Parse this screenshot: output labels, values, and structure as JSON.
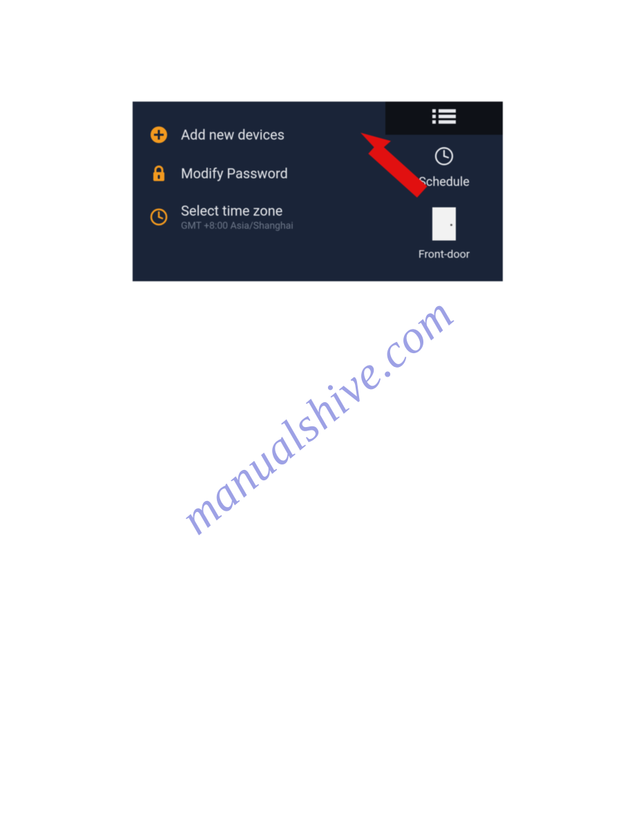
{
  "colors": {
    "panel_bg": "#1a2438",
    "topbar_bg": "#0e1117",
    "accent_orange": "#f39a1f",
    "text_primary": "#e6e8ec",
    "text_muted": "#6d7789",
    "arrow_red": "#e11010",
    "watermark": "#6a6fd8"
  },
  "menu": {
    "items": [
      {
        "label": "Add new devices",
        "icon": "plus-icon"
      },
      {
        "label": "Modify Password",
        "icon": "lock-icon"
      },
      {
        "label": "Select time zone",
        "sub": "GMT +8:00  Asia/Shanghai",
        "icon": "clock-icon"
      }
    ]
  },
  "right": {
    "schedule_label": "Schedule",
    "device_label": "Front-door"
  },
  "watermark": "manualshive.com"
}
